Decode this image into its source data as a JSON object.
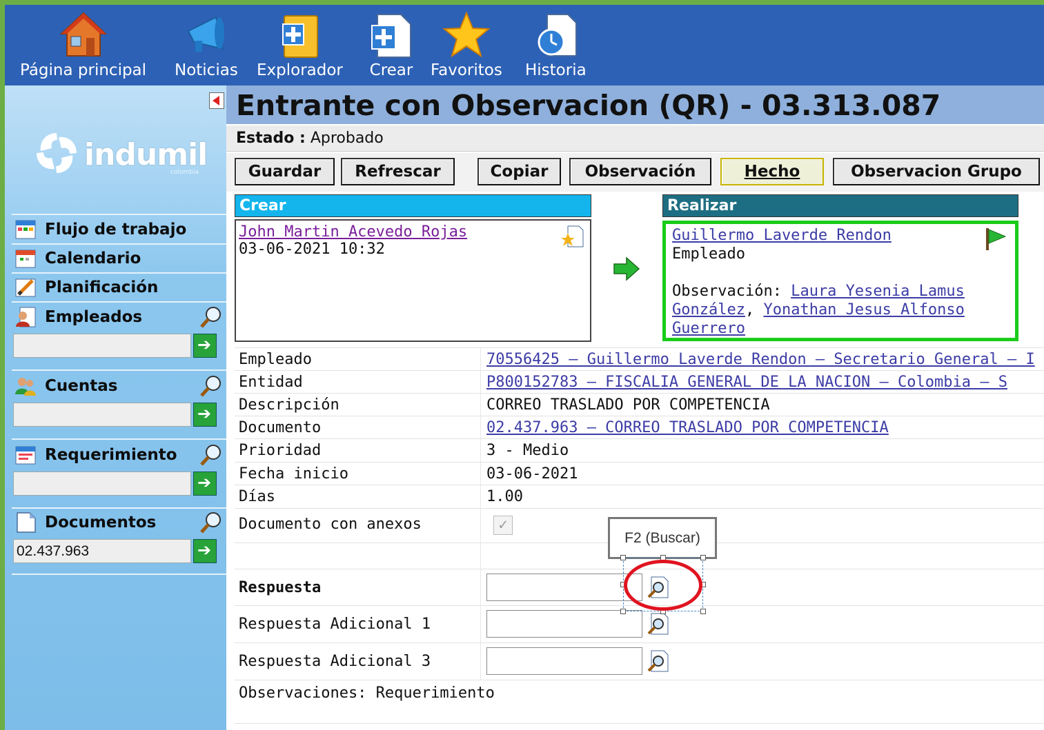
{
  "toolbar": {
    "items": [
      {
        "label": "Página principal",
        "icon": "home-icon"
      },
      {
        "label": "Noticias",
        "icon": "megaphone-icon"
      },
      {
        "label": "Explorador",
        "icon": "folder-add-icon"
      },
      {
        "label": "Crear",
        "icon": "new-document-icon"
      },
      {
        "label": "Favoritos",
        "icon": "star-icon"
      },
      {
        "label": "Historia",
        "icon": "history-clock-icon"
      }
    ]
  },
  "sidebar": {
    "logo": {
      "word": "indumil",
      "sub": "colombia"
    },
    "links": [
      {
        "label": "Flujo de trabajo",
        "icon": "workflow-icon"
      },
      {
        "label": "Calendario",
        "icon": "calendar-icon"
      },
      {
        "label": "Planificación",
        "icon": "planning-icon"
      }
    ],
    "sections": [
      {
        "label": "Empleados",
        "icon": "employee-icon",
        "input_value": ""
      },
      {
        "label": "Cuentas",
        "icon": "accounts-icon",
        "input_value": ""
      },
      {
        "label": "Requerimiento",
        "icon": "requirement-icon",
        "input_value": ""
      },
      {
        "label": "Documentos",
        "icon": "documents-icon",
        "input_value": "02.437.963"
      }
    ]
  },
  "header": {
    "title": "Entrante con Observacion (QR) - 03.313.087",
    "status_label": "Estado :",
    "status_value": "Aprobado"
  },
  "actions": {
    "guardar": "Guardar",
    "refrescar": "Refrescar",
    "copiar": "Copiar",
    "observacion": "Observación",
    "hecho": "Hecho",
    "observacion_grupo": "Observacion Grupo"
  },
  "crear": {
    "heading": "Crear",
    "user": "John Martin Acevedo Rojas",
    "datetime": "03-06-2021 10:32"
  },
  "realizar": {
    "heading": "Realizar",
    "user": "Guillermo Laverde Rendon",
    "role": "Empleado",
    "obs_label": "Observación:",
    "obs_user1_a": "Laura Yesenia Lamus",
    "obs_user1_b": "González",
    "obs_sep": ",",
    "obs_user2_a": "Yonathan Jesus Alfonso",
    "obs_user2_b": "Guerrero"
  },
  "fields": {
    "empleado": {
      "label": "Empleado",
      "value": "70556425 — Guillermo Laverde Rendon — Secretario General — I"
    },
    "entidad": {
      "label": "Entidad",
      "value": "P800152783 — FISCALIA GENERAL DE LA NACION — Colombia — S"
    },
    "descripcion": {
      "label": "Descripción",
      "value": "CORREO TRASLADO POR COMPETENCIA"
    },
    "documento": {
      "label": "Documento",
      "value": "02.437.963 — CORREO TRASLADO POR COMPETENCIA"
    },
    "prioridad": {
      "label": "Prioridad",
      "value": "3 - Medio"
    },
    "fecha_inicio": {
      "label": "Fecha inicio",
      "value": "03-06-2021"
    },
    "dias": {
      "label": "Días",
      "value": "1.00"
    },
    "anexos": {
      "label": "Documento con anexos",
      "checked": true
    },
    "respuesta": {
      "label": "Respuesta",
      "value": ""
    },
    "respuesta_ad1": {
      "label": "Respuesta Adicional 1",
      "value": ""
    },
    "respuesta_ad3": {
      "label": "Respuesta Adicional 3",
      "value": ""
    },
    "observaciones": {
      "label": "Observaciones: Requerimiento"
    }
  },
  "tooltip": {
    "text": "F2 (Buscar)"
  },
  "colors": {
    "toolbar_bg": "#2d61b5",
    "title_bg": "#8fb0dc",
    "crear_head": "#13b5ec",
    "realizar_head": "#1e6e83",
    "realizar_border": "#19cc19",
    "highlight_ring": "#e01420"
  }
}
